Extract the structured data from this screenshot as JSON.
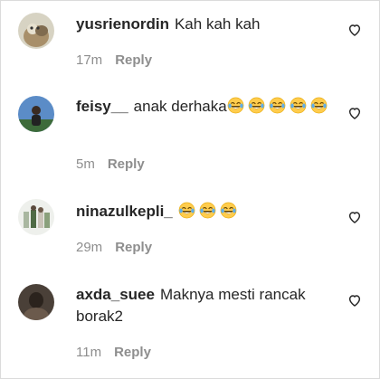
{
  "comments": [
    {
      "username": "yusrienordin",
      "text": "Kah kah kah",
      "emojis": [],
      "time": "17m",
      "reply_label": "Reply",
      "avatar_icon": "cat-avatar-icon"
    },
    {
      "username": "feisy__",
      "text": "anak derhaka",
      "emojis": [
        "face-with-tears-of-joy",
        "face-with-tears-of-joy",
        "face-with-tears-of-joy",
        "face-with-tears-of-joy",
        "face-with-tears-of-joy"
      ],
      "time": "5m",
      "reply_label": "Reply",
      "avatar_icon": "person-sky-avatar-icon"
    },
    {
      "username": "ninazulkepli_",
      "text": "",
      "emojis": [
        "face-with-tears-of-joy",
        "face-with-tears-of-joy",
        "face-with-tears-of-joy"
      ],
      "time": "29m",
      "reply_label": "Reply",
      "avatar_icon": "group-photo-avatar-icon"
    },
    {
      "username": "axda_suee",
      "text": "Maknya mesti rancak borak2",
      "emojis": [],
      "time": "11m",
      "reply_label": "Reply",
      "avatar_icon": "person-dark-avatar-icon"
    }
  ],
  "colors": {
    "text": "#262626",
    "meta": "#8e8e8e",
    "emoji_face": "#ffcc4d",
    "tears": "#5dadec"
  }
}
